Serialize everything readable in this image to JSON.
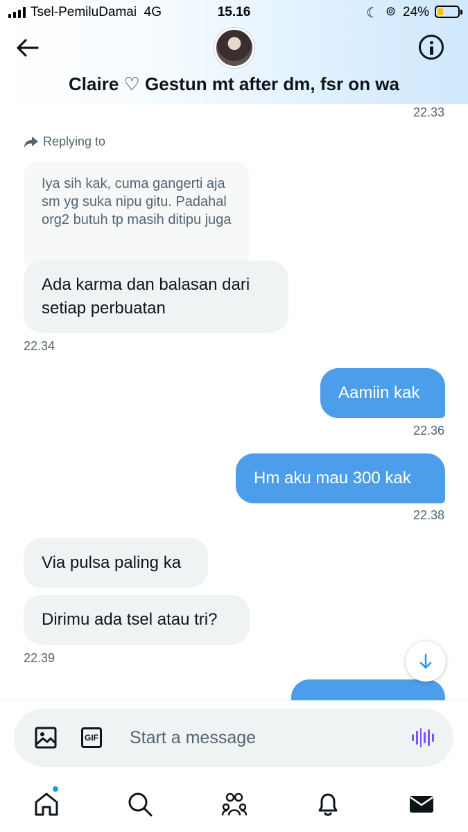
{
  "status_bar": {
    "carrier": "Tsel-PemiluDamai",
    "network": "4G",
    "time": "15.16",
    "battery": "24%"
  },
  "header": {
    "title": "Claire ♡ Gestun mt after dm, fsr on wa"
  },
  "messages": {
    "ts_top": "22.33",
    "reply_label": "Replying to",
    "reply_quote": "Iya sih kak, cuma gangerti aja sm yg suka nipu gitu. Padahal org2 butuh tp masih ditipu juga",
    "msg1": "Ada karma dan balasan dari setiap perbuatan",
    "ts1": "22.34",
    "msg2": "Aamiin kak",
    "ts2": "22.36",
    "msg3": "Hm aku mau 300 kak",
    "ts3": "22.38",
    "msg4": "Via pulsa paling ka",
    "msg5": "Dirimu ada tsel atau tri?",
    "ts4": "22.39"
  },
  "composer": {
    "placeholder": "Start a message",
    "gif_label": "GIF"
  },
  "colors": {
    "accent": "#1d9bf0",
    "outgoing_bubble": "#4c9eeb",
    "incoming_bubble": "#eff3f4",
    "voice": "#7856ff"
  },
  "nav": {
    "items": [
      "home-icon",
      "search-icon",
      "communities-icon",
      "notifications-icon",
      "messages-icon"
    ]
  }
}
